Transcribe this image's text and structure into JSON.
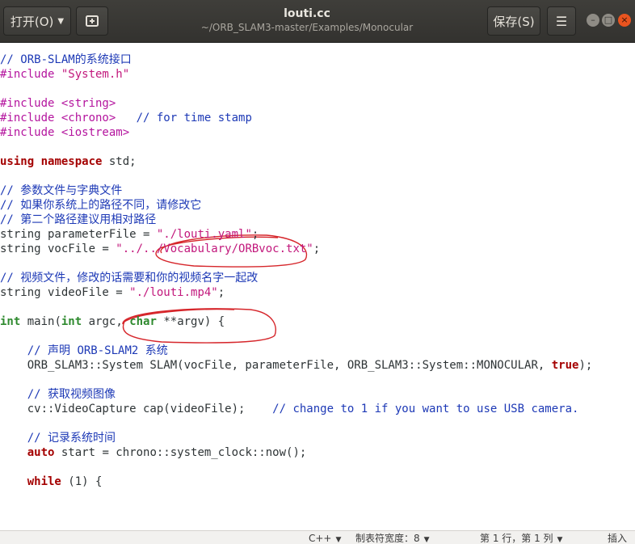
{
  "header": {
    "open_label": "打开(O)",
    "title": "louti.cc",
    "subtitle": "~/ORB_SLAM3-master/Examples/Monocular",
    "save_label": "保存(S)"
  },
  "code_lines": [
    [
      {
        "t": "// ORB-SLAM",
        "c": "cm"
      },
      {
        "t": "的系统接口",
        "c": "cm cjk"
      }
    ],
    [
      {
        "t": "#include ",
        "c": "pp"
      },
      {
        "t": "\"System.h\"",
        "c": "st"
      }
    ],
    [],
    [
      {
        "t": "#include <string>",
        "c": "pp"
      }
    ],
    [
      {
        "t": "#include <chrono>",
        "c": "pp"
      },
      {
        "t": "   // for time stamp",
        "c": "cm"
      }
    ],
    [
      {
        "t": "#include <iostream>",
        "c": "pp"
      }
    ],
    [],
    [
      {
        "t": "using",
        "c": "kw"
      },
      {
        "t": " "
      },
      {
        "t": "namespace",
        "c": "kw"
      },
      {
        "t": " std;"
      }
    ],
    [],
    [
      {
        "t": "// ",
        "c": "cm"
      },
      {
        "t": "参数文件与字典文件",
        "c": "cm cjk"
      }
    ],
    [
      {
        "t": "// ",
        "c": "cm"
      },
      {
        "t": "如果你系统上的路径不同，请修改它",
        "c": "cm cjk"
      }
    ],
    [
      {
        "t": "// ",
        "c": "cm"
      },
      {
        "t": "第二个路径建议用相对路径",
        "c": "cm cjk"
      }
    ],
    [
      {
        "t": "string parameterFile = "
      },
      {
        "t": "\"./louti.yaml\"",
        "c": "st"
      },
      {
        "t": ";"
      }
    ],
    [
      {
        "t": "string vocFile = "
      },
      {
        "t": "\"../../Vocabulary/ORBvoc.txt\"",
        "c": "st"
      },
      {
        "t": ";"
      }
    ],
    [],
    [
      {
        "t": "// ",
        "c": "cm"
      },
      {
        "t": "视频文件，修改的话需要和你的视频名字一起改",
        "c": "cm cjk"
      }
    ],
    [
      {
        "t": "string videoFile = "
      },
      {
        "t": "\"./louti.mp4\"",
        "c": "st"
      },
      {
        "t": ";"
      }
    ],
    [],
    [
      {
        "t": "int",
        "c": "ty"
      },
      {
        "t": " main("
      },
      {
        "t": "int",
        "c": "ty"
      },
      {
        "t": " argc, "
      },
      {
        "t": "char",
        "c": "ty"
      },
      {
        "t": " **argv) {"
      }
    ],
    [],
    [
      {
        "t": "    // ",
        "c": "cm"
      },
      {
        "t": "声明",
        "c": "cm cjk"
      },
      {
        "t": " ORB-SLAM2 ",
        "c": "cm"
      },
      {
        "t": "系统",
        "c": "cm cjk"
      }
    ],
    [
      {
        "t": "    ORB_SLAM3::System SLAM(vocFile, parameterFile, ORB_SLAM3::System::MONOCULAR, "
      },
      {
        "t": "true",
        "c": "bo"
      },
      {
        "t": ");"
      }
    ],
    [],
    [
      {
        "t": "    // ",
        "c": "cm"
      },
      {
        "t": "获取视频图像",
        "c": "cm cjk"
      }
    ],
    [
      {
        "t": "    cv::VideoCapture cap(videoFile);    "
      },
      {
        "t": "// change to 1 if you want to use USB camera.",
        "c": "cm"
      }
    ],
    [],
    [
      {
        "t": "    // ",
        "c": "cm"
      },
      {
        "t": "记录系统时间",
        "c": "cm cjk"
      }
    ],
    [
      {
        "t": "    "
      },
      {
        "t": "auto",
        "c": "kw"
      },
      {
        "t": " start = chrono::system_clock::now();"
      }
    ],
    [],
    [
      {
        "t": "    "
      },
      {
        "t": "while",
        "c": "kw"
      },
      {
        "t": " (1) {"
      }
    ]
  ],
  "status": {
    "language": "C++",
    "tab_width": "制表符宽度：8",
    "position": "第 1 行，第 1 列",
    "insert_mode": "插入"
  }
}
